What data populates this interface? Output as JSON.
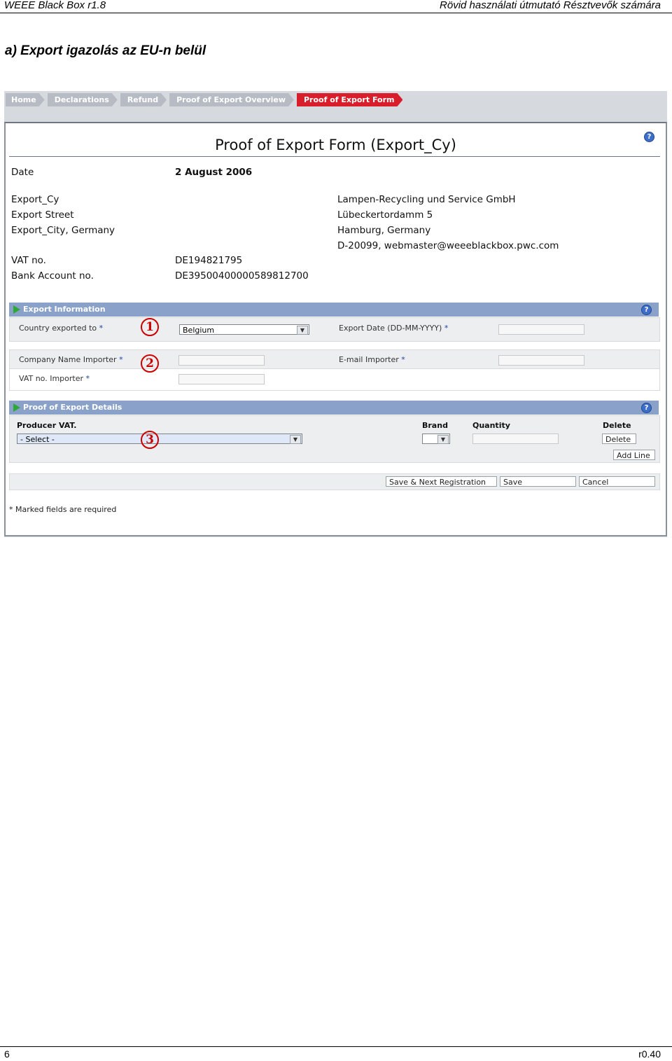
{
  "doc": {
    "header_left": "WEEE Black Box r1.8",
    "header_right": "Rövid használati útmutató Résztvevők számára",
    "section_title": "a) Export igazolás az EU-n belül",
    "page_number": "6",
    "version": "r0.40"
  },
  "breadcrumb": [
    "Home",
    "Declarations",
    "Refund",
    "Proof of Export Overview",
    "Proof of Export Form"
  ],
  "form": {
    "title": "Proof of Export Form (Export_Cy)",
    "help_icon": "?",
    "date_label": "Date",
    "date_value": "2 August 2006",
    "exporter": [
      "Export_Cy",
      "Export Street",
      "Export_City, Germany"
    ],
    "recipient": [
      "Lampen-Recycling und Service GmbH",
      "Lübeckertordamm 5",
      "Hamburg, Germany",
      "D-20099, webmaster@weeeblackbox.pwc.com"
    ],
    "vat_label": "VAT no.",
    "vat_value": "DE194821795",
    "bank_label": "Bank Account no.",
    "bank_value": "DE39500400000589812700"
  },
  "export_info": {
    "title": "Export Information",
    "country_label": "Country exported to",
    "country_value": "Belgium",
    "export_date_label": "Export Date (DD-MM-YYYY)",
    "company_label": "Company Name Importer",
    "email_label": "E-mail Importer",
    "vat_importer_label": "VAT no. Importer",
    "required_mark": "*"
  },
  "details": {
    "title": "Proof of Export Details",
    "producer_label": "Producer VAT.",
    "producer_value": "- Select -",
    "brand_label": "Brand",
    "quantity_label": "Quantity",
    "delete_label": "Delete",
    "delete_button": "Delete",
    "add_line_button": "Add Line"
  },
  "actions": {
    "save_next": "Save & Next Registration",
    "save": "Save",
    "cancel": "Cancel"
  },
  "required_note": "* Marked fields are required",
  "markers": [
    "1",
    "2",
    "3"
  ],
  "colors": {
    "active_crumb": "#d91e2b",
    "section_bar": "#8aa2c9",
    "marker": "#cc0000"
  }
}
